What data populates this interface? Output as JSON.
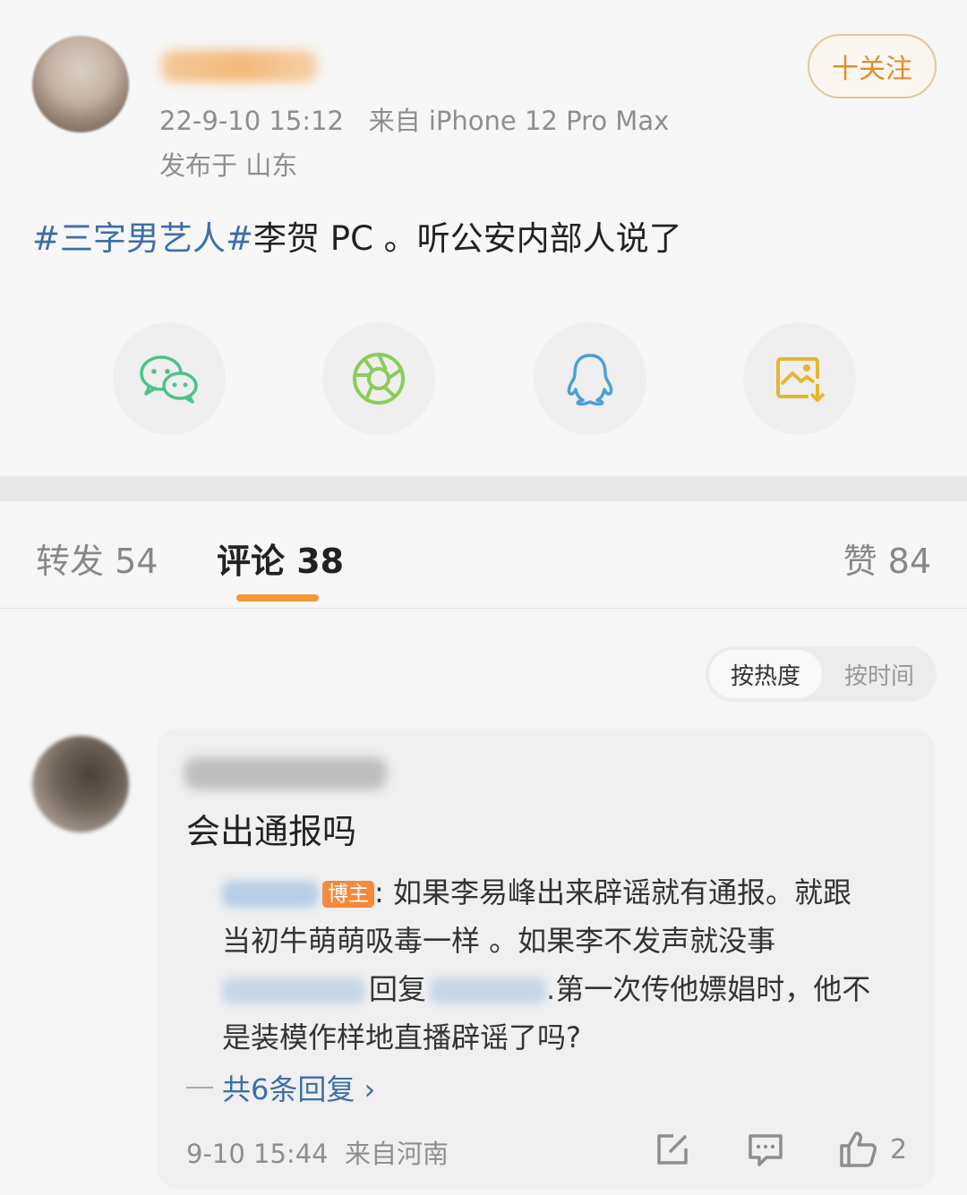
{
  "post": {
    "timestamp": "22-9-10 15:12",
    "source": "来自 iPhone 12 Pro Max",
    "location": "发布于 山东",
    "follow_label": "十关注",
    "topic": "#三字男艺人#",
    "text": "李贺 PC 。听公安内部人说了"
  },
  "share": {
    "items": [
      "wechat-icon",
      "moments-icon",
      "qq-icon",
      "save-image-icon"
    ]
  },
  "tabs": {
    "forward": "转发 54",
    "comment": "评论 38",
    "like": "赞 84"
  },
  "sort": {
    "hot": "按热度",
    "time": "按时间"
  },
  "comment": {
    "text": "会出通报吗",
    "blogger_badge": "博主",
    "reply_line1": ": 如果李易峰出来辟谣就有通报。就跟",
    "reply_line2": "当初牛萌萌吸毒一样 。如果李不发声就没事",
    "reply_word": "回复",
    "reply_line3_tail": ".第一次传他嫖娼时，他不",
    "reply_line4": "是装模作样地直播辟谣了吗?",
    "reply_count": "共6条回复 ›",
    "timestamp": "9-10 15:44",
    "source": "来自河南",
    "like_count": "2"
  },
  "colors": {
    "accent": "#f09a36",
    "link": "#3d6ea8",
    "wechat": "#4cc28a",
    "moments": "#8ccc5a",
    "qq": "#4ba0d8",
    "save": "#e7b52f"
  }
}
